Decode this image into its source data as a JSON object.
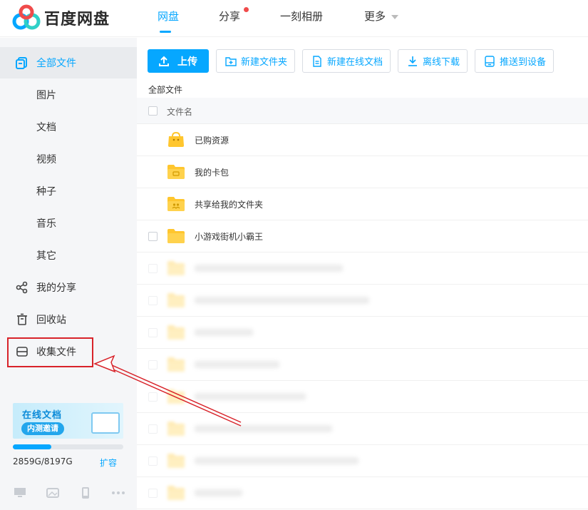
{
  "app": {
    "name": "百度网盘"
  },
  "nav": {
    "items": [
      {
        "label": "网盘",
        "active": true
      },
      {
        "label": "分享",
        "dot": true
      },
      {
        "label": "一刻相册"
      },
      {
        "label": "更多",
        "caret": true
      }
    ]
  },
  "sidebar": {
    "items": [
      {
        "label": "全部文件",
        "icon": "all-files-icon",
        "active": true
      },
      {
        "label": "图片"
      },
      {
        "label": "文档"
      },
      {
        "label": "视频"
      },
      {
        "label": "种子"
      },
      {
        "label": "音乐"
      },
      {
        "label": "其它"
      },
      {
        "label": "我的分享",
        "icon": "share-icon"
      },
      {
        "label": "回收站",
        "icon": "trash-icon"
      },
      {
        "label": "收集文件",
        "icon": "collect-icon"
      }
    ],
    "banner": {
      "title": "在线文档",
      "badge": "内测邀请"
    },
    "quota": {
      "text": "2859G/8197G",
      "used_fraction": 0.349,
      "expand_label": "扩容"
    }
  },
  "toolbar": {
    "upload": "上传",
    "new_folder": "新建文件夹",
    "new_doc": "新建在线文档",
    "offline_download": "离线下载",
    "push_device": "推送到设备"
  },
  "breadcrumb": "全部文件",
  "table": {
    "header": "文件名",
    "rows": [
      {
        "name": "已购资源",
        "type": "purchased"
      },
      {
        "name": "我的卡包",
        "type": "card"
      },
      {
        "name": "共享给我的文件夹",
        "type": "shared"
      },
      {
        "name": "小游戏街机小霸王",
        "type": "folder"
      },
      {
        "name": "",
        "type": "folder",
        "blurred": true
      },
      {
        "name": "",
        "type": "folder",
        "blurred": true
      },
      {
        "name": "",
        "type": "folder",
        "blurred": true
      },
      {
        "name": "",
        "type": "folder",
        "blurred": true
      },
      {
        "name": "",
        "type": "folder",
        "blurred": true
      },
      {
        "name": "",
        "type": "folder",
        "blurred": true
      },
      {
        "name": "",
        "type": "folder",
        "blurred": true
      },
      {
        "name": "",
        "type": "folder",
        "blurred": true
      }
    ]
  },
  "colors": {
    "accent": "#06a7ff",
    "folder": "#ffc62e",
    "highlight": "#d8232a"
  }
}
